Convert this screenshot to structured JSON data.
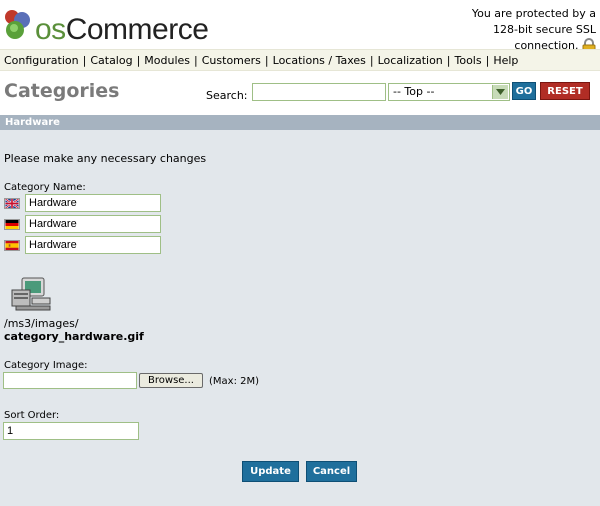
{
  "header": {
    "logo_text_os": "os",
    "logo_text_commerce": "Commerce",
    "ssl_line1": "You are protected by a",
    "ssl_line2": "128-bit secure SSL",
    "ssl_line3": "connection."
  },
  "menu": {
    "items": [
      "Configuration",
      "Catalog",
      "Modules",
      "Customers",
      "Locations / Taxes",
      "Localization",
      "Tools",
      "Help"
    ]
  },
  "page": {
    "title": "Categories",
    "search_label": "Search:",
    "search_value": "",
    "select_value": "-- Top --",
    "go_label": "GO",
    "reset_label": "RESET"
  },
  "section": {
    "title": "Hardware",
    "intro": "Please make any necessary changes",
    "category_name_label": "Category Name:",
    "names": [
      {
        "lang": "english",
        "value": "Hardware"
      },
      {
        "lang": "german",
        "value": "Hardware"
      },
      {
        "lang": "spanish",
        "value": "Hardware"
      }
    ],
    "image_path": "/ms3/images/",
    "image_filename": "category_hardware.gif",
    "category_image_label": "Category Image:",
    "browse_label": "Browse...",
    "max_note": "(Max: 2M)",
    "sort_order_label": "Sort Order:",
    "sort_order_value": "1",
    "update_label": "Update",
    "cancel_label": "Cancel"
  }
}
